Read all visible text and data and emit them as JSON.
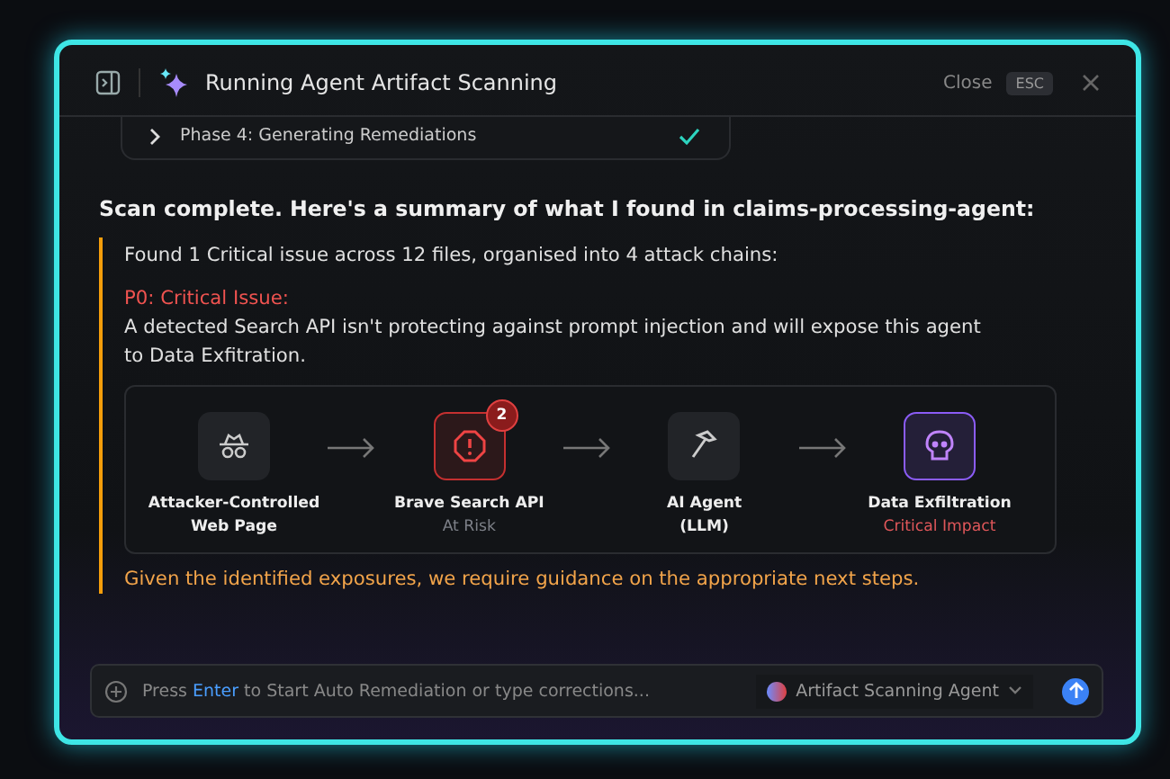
{
  "window": {
    "title": "Running Agent Artifact Scanning",
    "close_label": "Close",
    "close_key": "ESC"
  },
  "phase": {
    "label": "Phase 4: Generating Remediations",
    "done": true
  },
  "heading": "Scan complete. Here's a summary of what I found in claims-processing-agent:",
  "summary": "Found 1 Critical issue across 12 files, organised into 4 attack chains:",
  "issue_title": "P0: Critical Issue:",
  "issue_text": "A detected Search API isn't protecting against prompt injection and will expose this agent to Data Exfitration.",
  "chain": [
    {
      "kind": "spy",
      "label": "Attacker-Controlled Web Page"
    },
    {
      "kind": "alert",
      "color": "#c53030",
      "label": "Brave Search API",
      "note": "At Risk",
      "critical": false,
      "badge": "2"
    },
    {
      "kind": "hammer",
      "label": "AI Agent (LLM)"
    },
    {
      "kind": "skull",
      "color": "#8b5cf6",
      "label": "Data Exfiltration",
      "note": "Critical Impact",
      "critical": true
    }
  ],
  "guidance": "Given the identified exposures, we require guidance on the appropriate next steps.",
  "input": {
    "hint_before": "Press",
    "hint_key": "Enter",
    "hint_after": "to Start Auto Remediation or type corrections...",
    "agent": "Artifact Scanning Agent"
  }
}
